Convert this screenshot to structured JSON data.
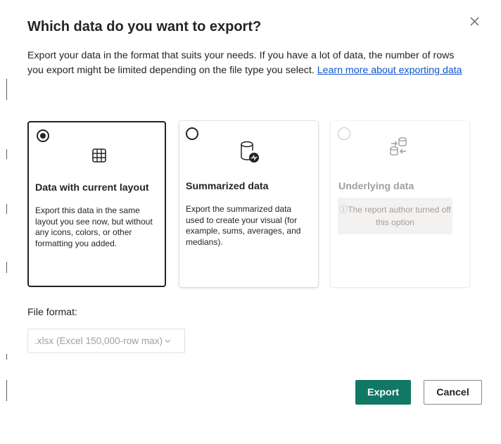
{
  "dialog": {
    "title": "Which data do you want to export?",
    "description": "Export your data in the format that suits your needs. If you have a lot of data, the number of rows you export might be limited depending on the file type you select.",
    "learn_more": "Learn more about exporting data"
  },
  "options": [
    {
      "title": "Data with current layout",
      "description": "Export this data in the same layout you see now, but without any icons, colors, or other formatting you added.",
      "selected": true,
      "icon": "table-grid-icon"
    },
    {
      "title": "Summarized data",
      "description": "Export the summarized data used to create your visual (for example, sums, averages, and medians).",
      "selected": false,
      "icon": "database-chart-icon"
    },
    {
      "title": "Underlying data",
      "disabled_note": "ⓘThe report author turned off this option",
      "selected": false,
      "disabled": true,
      "icon": "database-transfer-icon"
    }
  ],
  "file_format": {
    "label": "File format:",
    "value": ".xlsx (Excel 150,000-row max)"
  },
  "buttons": {
    "export": "Export",
    "cancel": "Cancel"
  },
  "colors": {
    "primary": "#117865",
    "link": "#1155cc",
    "text": "#252423",
    "disabled_text": "#a19f9d"
  }
}
